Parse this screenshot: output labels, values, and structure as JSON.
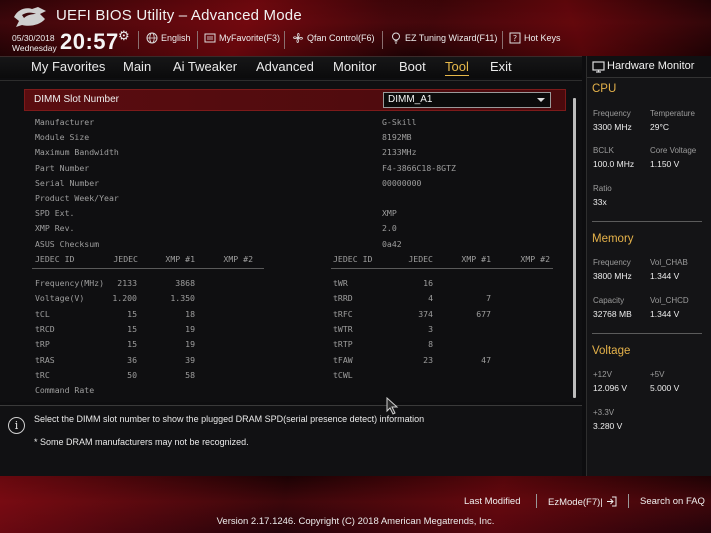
{
  "header": {
    "title": "UEFI BIOS Utility – Advanced Mode",
    "date": "05/30/2018",
    "weekday": "Wednesday",
    "time": "20:57",
    "buttons": {
      "language": "English",
      "myfavorite": "MyFavorite(F3)",
      "qfan": "Qfan Control(F6)",
      "ez_tuning": "EZ Tuning Wizard(F11)",
      "hotkeys": "Hot Keys"
    }
  },
  "menu": {
    "items": [
      "My Favorites",
      "Main",
      "Ai Tweaker",
      "Advanced",
      "Monitor",
      "Boot",
      "Tool",
      "Exit"
    ],
    "active": "Tool"
  },
  "spd": {
    "slot_label": "DIMM Slot Number",
    "slot_value": "DIMM_A1",
    "info": [
      {
        "label": "Manufacturer",
        "value": "G-Skill"
      },
      {
        "label": "Module Size",
        "value": "8192MB"
      },
      {
        "label": "Maximum Bandwidth",
        "value": "2133MHz"
      },
      {
        "label": "Part Number",
        "value": "F4-3866C18-8GTZ"
      },
      {
        "label": "Serial Number",
        "value": "00000000"
      },
      {
        "label": "Product Week/Year",
        "value": ""
      },
      {
        "label": "SPD Ext.",
        "value": "XMP"
      },
      {
        "label": "XMP Rev.",
        "value": "2.0"
      },
      {
        "label": "ASUS Checksum",
        "value": "0a42"
      }
    ],
    "left_headers": [
      "JEDEC ID",
      "JEDEC",
      "XMP #1",
      "XMP #2"
    ],
    "right_headers": [
      "JEDEC ID",
      "JEDEC",
      "XMP #1",
      "XMP #2"
    ],
    "left_rows": [
      {
        "name": "Frequency(MHz)",
        "jedec": "2133",
        "xmp1": "3868",
        "xmp2": ""
      },
      {
        "name": "Voltage(V)",
        "jedec": "1.200",
        "xmp1": "1.350",
        "xmp2": ""
      },
      {
        "name": "tCL",
        "jedec": "15",
        "xmp1": "18",
        "xmp2": ""
      },
      {
        "name": "tRCD",
        "jedec": "15",
        "xmp1": "19",
        "xmp2": ""
      },
      {
        "name": "tRP",
        "jedec": "15",
        "xmp1": "19",
        "xmp2": ""
      },
      {
        "name": "tRAS",
        "jedec": "36",
        "xmp1": "39",
        "xmp2": ""
      },
      {
        "name": "tRC",
        "jedec": "50",
        "xmp1": "58",
        "xmp2": ""
      },
      {
        "name": "Command Rate",
        "jedec": "",
        "xmp1": "",
        "xmp2": ""
      }
    ],
    "right_rows": [
      {
        "name": "tWR",
        "jedec": "16",
        "xmp1": "",
        "xmp2": ""
      },
      {
        "name": "tRRD",
        "jedec": "4",
        "xmp1": "7",
        "xmp2": ""
      },
      {
        "name": "tRFC",
        "jedec": "374",
        "xmp1": "677",
        "xmp2": ""
      },
      {
        "name": "tWTR",
        "jedec": "3",
        "xmp1": "",
        "xmp2": ""
      },
      {
        "name": "tRTP",
        "jedec": "8",
        "xmp1": "",
        "xmp2": ""
      },
      {
        "name": "tFAW",
        "jedec": "23",
        "xmp1": "47",
        "xmp2": ""
      },
      {
        "name": "tCWL",
        "jedec": "",
        "xmp1": "",
        "xmp2": ""
      }
    ]
  },
  "help": {
    "line1": "Select the DIMM slot number to show the plugged DRAM SPD(serial presence detect) information",
    "line2": "* Some DRAM manufacturers may not be recognized."
  },
  "hardware_monitor": {
    "title": "Hardware Monitor",
    "cpu": {
      "title": "CPU",
      "frequency_label": "Frequency",
      "frequency": "3300 MHz",
      "temperature_label": "Temperature",
      "temperature": "29°C",
      "bclk_label": "BCLK",
      "bclk": "100.0 MHz",
      "core_voltage_label": "Core Voltage",
      "core_voltage": "1.150 V",
      "ratio_label": "Ratio",
      "ratio": "33x"
    },
    "memory": {
      "title": "Memory",
      "frequency_label": "Frequency",
      "frequency": "3800 MHz",
      "vol_chab_label": "Vol_CHAB",
      "vol_chab": "1.344 V",
      "capacity_label": "Capacity",
      "capacity": "32768 MB",
      "vol_chcd_label": "Vol_CHCD",
      "vol_chcd": "1.344 V"
    },
    "voltage": {
      "title": "Voltage",
      "v12_label": "+12V",
      "v12": "12.096 V",
      "v5_label": "+5V",
      "v5": "5.000 V",
      "v33_label": "+3.3V",
      "v33": "3.280 V"
    }
  },
  "footer": {
    "last_modified": "Last Modified",
    "ezmode": "EzMode(F7)|",
    "search": "Search on FAQ",
    "copyright": "Version 2.17.1246. Copyright (C) 2018 American Megatrends, Inc."
  },
  "colors": {
    "accent": "#e7b94a",
    "header_red": "#3b070b",
    "selected_row": "#5a0d10"
  }
}
